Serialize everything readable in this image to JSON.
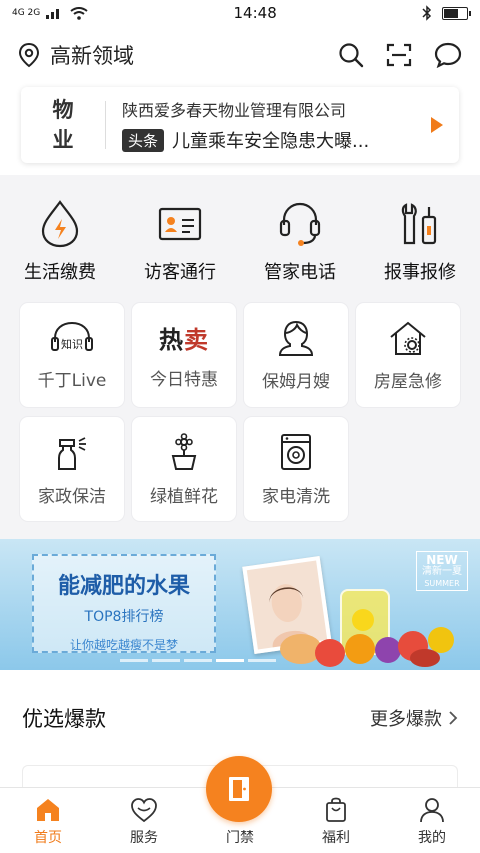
{
  "status_bar": {
    "time": "14:48",
    "signal_text": "4G 2G",
    "battery_level": 0.7
  },
  "header": {
    "location": "高新领域",
    "icons": [
      "location-pin-icon",
      "search-icon",
      "scan-icon",
      "message-icon"
    ]
  },
  "notice": {
    "tag_line1": "物",
    "tag_line2": "业",
    "company": "陕西爱多春天物业管理有限公司",
    "badge": "头条",
    "headline": "儿童乘车安全隐患大曝..."
  },
  "services": [
    {
      "label": "生活缴费",
      "icon": "water-bill-icon"
    },
    {
      "label": "访客通行",
      "icon": "visitor-card-icon"
    },
    {
      "label": "管家电话",
      "icon": "headset-icon"
    },
    {
      "label": "报事报修",
      "icon": "repair-tools-icon"
    }
  ],
  "cards": [
    {
      "label": "千丁Live",
      "icon": "knowledge-headphone-icon",
      "icon_text": "知识"
    },
    {
      "label": "今日特惠",
      "icon": "hot-sale-icon",
      "icon_text": "热卖"
    },
    {
      "label": "保姆月嫂",
      "icon": "nanny-icon"
    },
    {
      "label": "房屋急修",
      "icon": "house-repair-icon"
    },
    {
      "label": "家政保洁",
      "icon": "spray-bottle-icon"
    },
    {
      "label": "绿植鲜花",
      "icon": "flower-pot-icon"
    },
    {
      "label": "家电清洗",
      "icon": "washing-machine-icon"
    }
  ],
  "banner": {
    "title": "能减肥的水果",
    "subtitle": "TOP8排行榜",
    "caption": "让你越吃越瘦不是梦",
    "tag_main": "NEW",
    "tag_sub": "清新一夏",
    "tag_en": "SUMMER",
    "accent": "#1e5da8"
  },
  "section": {
    "title": "优选爆款",
    "more": "更多爆款"
  },
  "tabbar": [
    {
      "label": "首页",
      "icon": "home-icon",
      "active": true
    },
    {
      "label": "服务",
      "icon": "heart-icon",
      "active": false
    },
    {
      "label": "门禁",
      "icon": "door-icon",
      "active": false
    },
    {
      "label": "福利",
      "icon": "shopping-bag-icon",
      "active": false
    },
    {
      "label": "我的",
      "icon": "user-icon",
      "active": false
    }
  ],
  "colors": {
    "accent": "#f07b1a",
    "text": "#222222",
    "background_gray": "#f4f4f6"
  }
}
